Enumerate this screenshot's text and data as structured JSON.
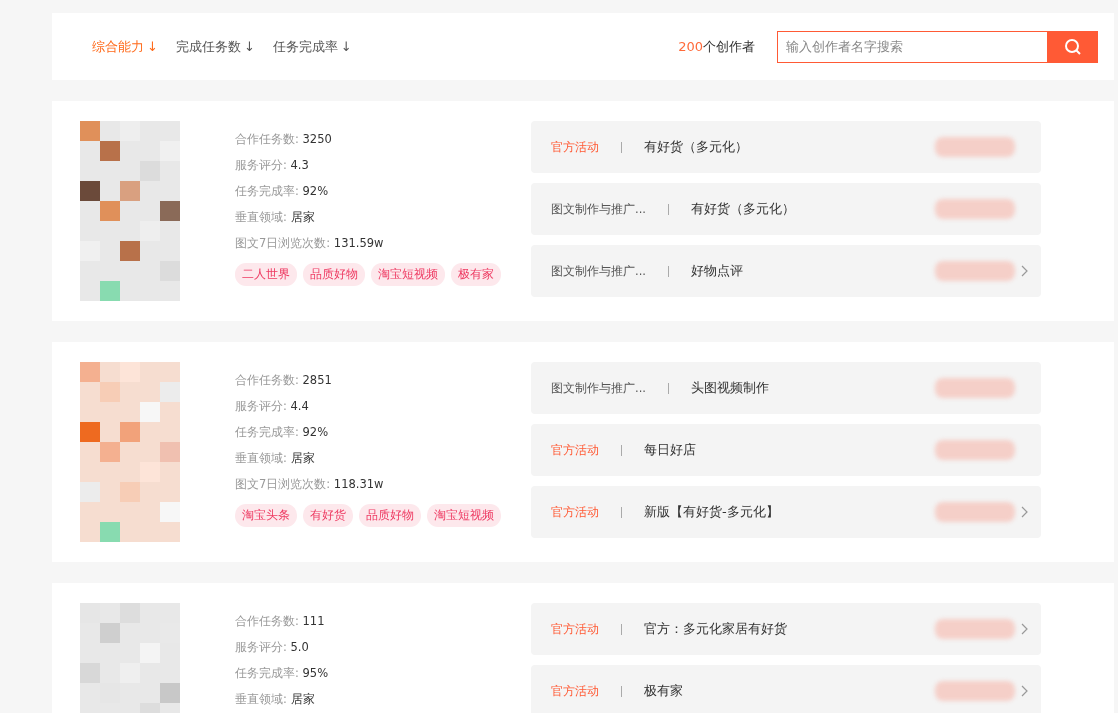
{
  "sort_tabs": [
    {
      "label": "综合能力",
      "arrow": "↓",
      "selected": true
    },
    {
      "label": "完成任务数",
      "arrow": "↓",
      "selected": false
    },
    {
      "label": "任务完成率",
      "arrow": "↓",
      "selected": false
    }
  ],
  "count": {
    "number": "200",
    "label": "个创作者"
  },
  "search": {
    "placeholder": "输入创作者名字搜索"
  },
  "creators": [
    {
      "avatar": {
        "kind": "picture"
      },
      "stats": [
        {
          "label": "合作任务数:",
          "value": "3250"
        },
        {
          "label": "服务评分:",
          "value": "4.3"
        },
        {
          "label": "任务完成率:",
          "value": "92%"
        },
        {
          "label": "垂直领域:",
          "value": "居家"
        },
        {
          "label": "图文7日浏览次数:",
          "value": "131.59w"
        }
      ],
      "tags": [
        "二人世界",
        "品质好物",
        "淘宝短视频",
        "极有家"
      ],
      "tasks": [
        {
          "kind": "official",
          "category": "官方活动",
          "title": "有好货（多元化）",
          "chevron": false
        },
        {
          "kind": "service",
          "category": "图文制作与推广...",
          "title": "有好货（多元化）",
          "chevron": false
        },
        {
          "kind": "service",
          "category": "图文制作与推广...",
          "title": "好物点评",
          "chevron": true
        }
      ]
    },
    {
      "avatar": {
        "kind": "picture"
      },
      "stats": [
        {
          "label": "合作任务数:",
          "value": "2851"
        },
        {
          "label": "服务评分:",
          "value": "4.4"
        },
        {
          "label": "任务完成率:",
          "value": "92%"
        },
        {
          "label": "垂直领域:",
          "value": "居家"
        },
        {
          "label": "图文7日浏览次数:",
          "value": "118.31w"
        }
      ],
      "tags": [
        "淘宝头条",
        "有好货",
        "品质好物",
        "淘宝短视频"
      ],
      "tasks": [
        {
          "kind": "service",
          "category": "图文制作与推广...",
          "title": "头图视频制作",
          "chevron": false
        },
        {
          "kind": "official",
          "category": "官方活动",
          "title": "每日好店",
          "chevron": false
        },
        {
          "kind": "official",
          "category": "官方活动",
          "title": "新版【有好货-多元化】",
          "chevron": true
        }
      ]
    },
    {
      "avatar": {
        "kind": "picture"
      },
      "stats": [
        {
          "label": "合作任务数:",
          "value": "111"
        },
        {
          "label": "服务评分:",
          "value": "5.0"
        },
        {
          "label": "任务完成率:",
          "value": "95%"
        },
        {
          "label": "垂直领域:",
          "value": "居家"
        }
      ],
      "tasks": [
        {
          "kind": "official",
          "category": "官方活动",
          "title": "官方：多元化家居有好货",
          "chevron": true
        },
        {
          "kind": "official",
          "category": "官方活动",
          "title": "极有家",
          "chevron": true
        }
      ]
    }
  ]
}
